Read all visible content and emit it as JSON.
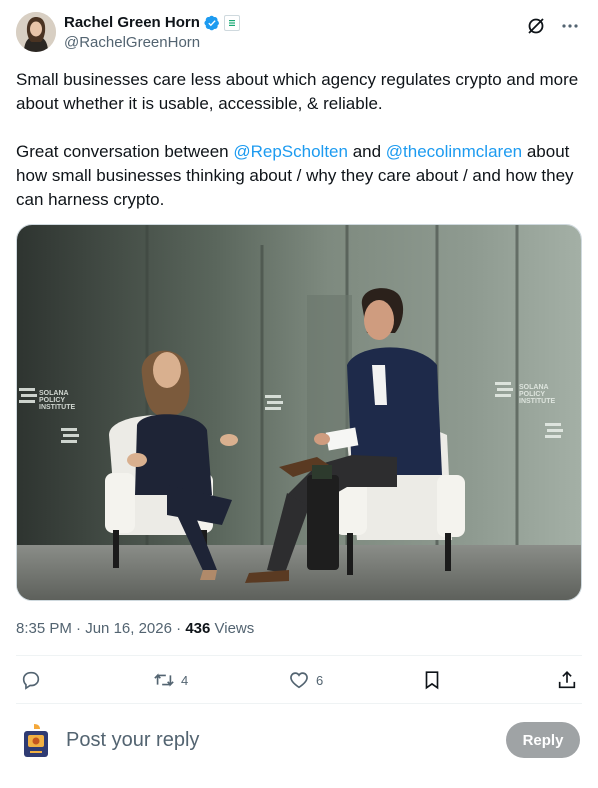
{
  "author": {
    "display_name": "Rachel Green Horn",
    "handle": "@RachelGreenHorn",
    "verified": true
  },
  "tweet": {
    "paragraph1": "Small businesses care less about which agency regulates crypto and more about whether it is usable, accessible, & reliable.",
    "p2_before": "Great conversation between ",
    "mention1": "@RepScholten",
    "p2_middle": " and ",
    "mention2": "@thecolinmclaren",
    "p2_after": " about how small businesses thinking about / why they care about / and how they can harness crypto."
  },
  "media": {
    "backdrop_brand_lines": [
      "SOLANA",
      "POLICY",
      "INSTITUTE"
    ]
  },
  "meta": {
    "time": "8:35 PM",
    "separator": " · ",
    "date": "Jun 16, 2026",
    "views_count": "436",
    "views_label": " Views"
  },
  "actions": {
    "retweets": "4",
    "likes": "6"
  },
  "reply": {
    "placeholder": "Post your reply",
    "button_label": "Reply"
  },
  "colors": {
    "accent": "#1d9bf0",
    "muted": "#536471",
    "text": "#0f1419"
  },
  "icons": [
    "verified-badge-icon",
    "affiliate-badge-icon",
    "grok-icon",
    "more-icon",
    "reply-icon",
    "retweet-icon",
    "like-icon",
    "bookmark-icon",
    "share-icon"
  ]
}
